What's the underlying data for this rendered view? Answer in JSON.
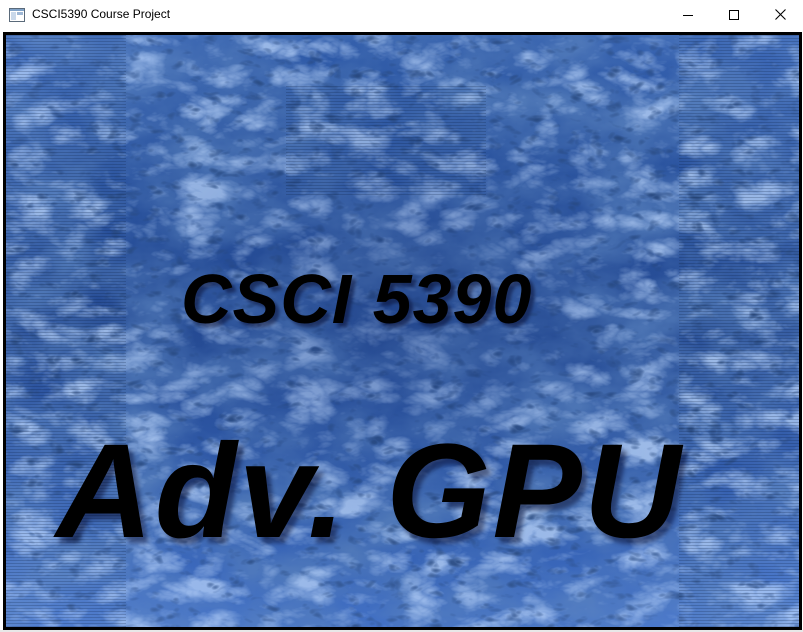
{
  "window": {
    "title": "CSCI5390 Course Project",
    "app_icon": "window-app-icon",
    "controls": {
      "minimize_icon": "minimize-icon",
      "maximize_icon": "maximize-icon",
      "close_icon": "close-icon"
    }
  },
  "render": {
    "line1": "CSCI 5390",
    "line2": "Adv. GPU",
    "colors": {
      "smoke_dark": "#0a1a3a",
      "smoke_mid": "#3a6bc0",
      "smoke_light": "#8fb6ff",
      "text": "#000000",
      "frame": "#000000"
    }
  }
}
